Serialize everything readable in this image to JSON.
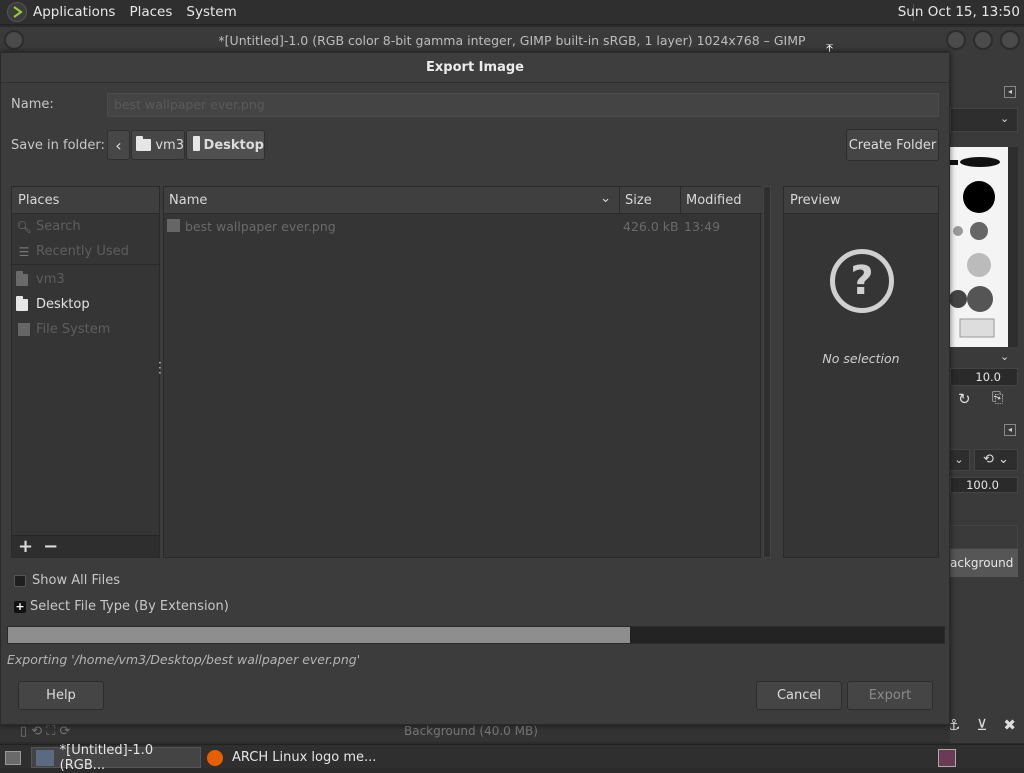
{
  "top_panel": {
    "menus": [
      "Applications",
      "Places",
      "System"
    ],
    "clock": "Sun Oct 15, 13:50"
  },
  "gimp_window": {
    "title": "*[Untitled]-1.0 (RGB color 8-bit gamma integer, GIMP built-in sRGB, 1 layer) 1024x768 – GIMP",
    "brush_size": "10.0",
    "opacity": "100.0",
    "layer_name_fragment": "ackground",
    "bottom_layer_text": "Background (40.0 MB)"
  },
  "dialog": {
    "title": "Export Image",
    "name_label": "Name:",
    "name_value": "best wallpaper ever.png",
    "save_in_label": "Save in folder:",
    "path": [
      "vm3",
      "Desktop"
    ],
    "create_folder": "Create Folder",
    "places": {
      "header": "Places",
      "items": [
        {
          "label": "Search",
          "icon": "search-icon",
          "enabled": false
        },
        {
          "label": "Recently Used",
          "icon": "recent-icon",
          "enabled": false
        },
        {
          "label": "vm3",
          "icon": "folder-icon",
          "enabled": false
        },
        {
          "label": "Desktop",
          "icon": "folder-icon",
          "enabled": true
        },
        {
          "label": "File System",
          "icon": "drive-icon",
          "enabled": false
        }
      ]
    },
    "files": {
      "columns": [
        "Name",
        "Size",
        "Modified"
      ],
      "rows": [
        {
          "name": "best wallpaper ever.png",
          "size": "426.0 kB",
          "modified": "13:49"
        }
      ]
    },
    "preview": {
      "header": "Preview",
      "empty_text": "No selection"
    },
    "show_all_files": "Show All Files",
    "select_file_type": "Select File Type (By Extension)",
    "progress": 0.665,
    "status": "Exporting '/home/vm3/Desktop/best wallpaper ever.png'",
    "help": "Help",
    "cancel": "Cancel",
    "export": "Export"
  },
  "taskbar": {
    "tasks": [
      "*[Untitled]-1.0 (RGB...",
      "ARCH Linux logo me..."
    ]
  }
}
